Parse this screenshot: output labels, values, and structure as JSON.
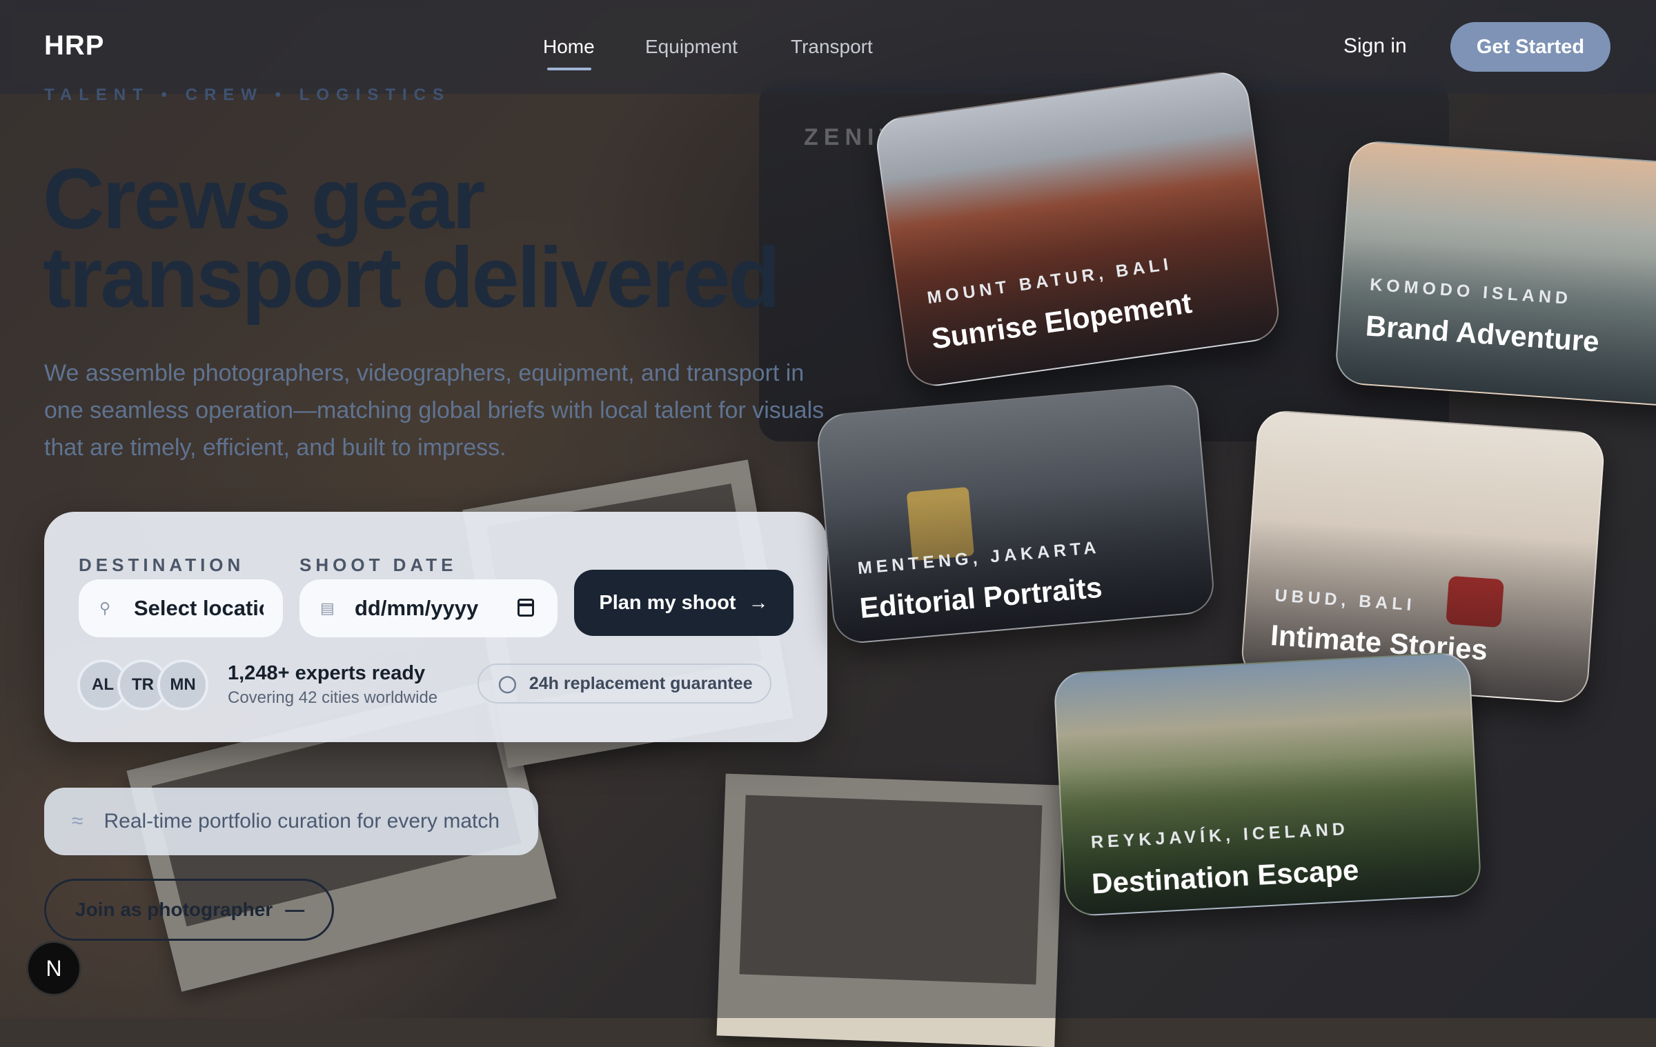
{
  "nav": {
    "logo": "HRP",
    "links": [
      "Home",
      "Equipment",
      "Transport"
    ],
    "active_link": "Home",
    "sign_in": "Sign in",
    "get_started": "Get Started"
  },
  "hero": {
    "eyebrow": "TALENT • CREW • LOGISTICS",
    "headline_line1": "Crews gear",
    "headline_line2": "transport delivered",
    "subcopy": "We assemble photographers, videographers, equipment, and transport in one seamless operation—matching global briefs with local talent for visuals that are timely, efficient, and built to impress."
  },
  "form": {
    "destination_label": "DESTINATION",
    "destination_placeholder": "Select location",
    "shoot_date_label": "SHOOT DATE",
    "shoot_date_placeholder": "dd/mm/yyyy",
    "submit_label": "Plan my shoot",
    "avatars": [
      "AL",
      "TR",
      "MN"
    ],
    "experts_text": "1,248+ experts ready",
    "cities_text": "Covering 42 cities worldwide",
    "guarantee_text": "24h replacement guarantee"
  },
  "curation_text": "Real-time portfolio curation for every match",
  "join_label": "Join as photographer",
  "badge_letter": "N",
  "background_camera_label": "ZENIT",
  "cards": [
    {
      "location": "MOUNT BATUR, BALI",
      "title": "Sunrise Elopement"
    },
    {
      "location": "KOMODO ISLAND",
      "title": "Brand Adventure"
    },
    {
      "location": "MENTENG, JAKARTA",
      "title": "Editorial Portraits"
    },
    {
      "location": "UBUD, BALI",
      "title": "Intimate Stories"
    },
    {
      "location": "REYKJAVÍK, ICELAND",
      "title": "Destination Escape"
    }
  ],
  "colors": {
    "accent": "#7e93b6",
    "dark_button": "#1a2433",
    "headline": "#1e2b3c"
  }
}
